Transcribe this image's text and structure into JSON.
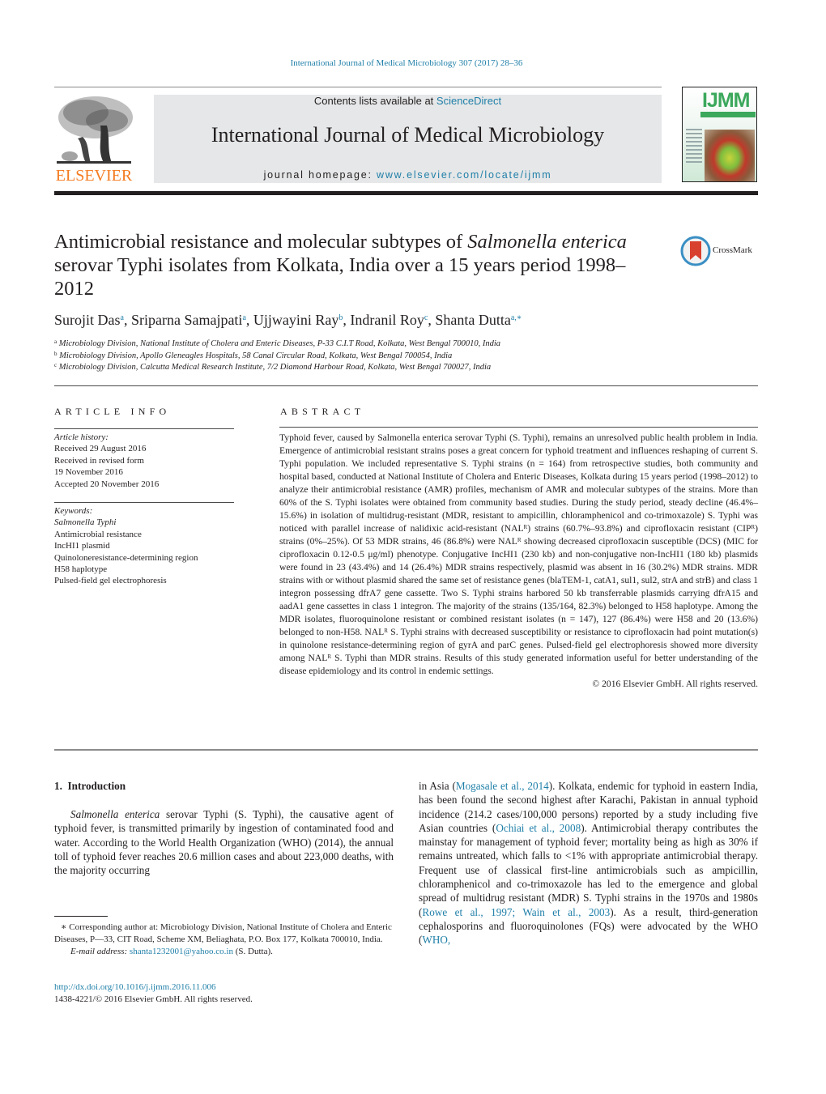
{
  "header": {
    "journal_ref": "International Journal of Medical Microbiology 307 (2017) 28–36",
    "publisher_logo_text": "ELSEVIER",
    "contents_prefix": "Contents lists available at ",
    "contents_link": "ScienceDirect",
    "journal_title": "International Journal of Medical Microbiology",
    "homepage_prefix": "journal homepage: ",
    "homepage_link": "www.elsevier.com/locate/ijmm",
    "cover_title": "IJMM",
    "colors": {
      "link": "#1f7fa8",
      "elsevier_orange": "#f47b20",
      "header_box": "#e6e7e8",
      "cover_green": "#3ba85c"
    }
  },
  "article": {
    "title_part1": "Antimicrobial resistance and molecular subtypes of ",
    "title_italic1": "Salmonella enterica",
    "title_part2": " serovar Typhi isolates from Kolkata, India over a 15 years period 1998–2012",
    "crossmark_label": "CrossMark",
    "authors": [
      {
        "name": "Surojit Das",
        "sup": "a"
      },
      {
        "name": "Sriparna Samajpati",
        "sup": "a"
      },
      {
        "name": "Ujjwayini Ray",
        "sup": "b"
      },
      {
        "name": "Indranil Roy",
        "sup": "c"
      },
      {
        "name": "Shanta Dutta",
        "sup": "a,∗"
      }
    ],
    "affiliations": [
      {
        "sup": "a",
        "text": "Microbiology Division, National Institute of Cholera and Enteric Diseases, P-33 C.I.T Road, Kolkata, West Bengal 700010, India"
      },
      {
        "sup": "b",
        "text": "Microbiology Division, Apollo Gleneagles Hospitals, 58 Canal Circular Road, Kolkata, West Bengal 700054, India"
      },
      {
        "sup": "c",
        "text": "Microbiology Division, Calcutta Medical Research Institute, 7/2 Diamond Harbour Road, Kolkata, West Bengal 700027, India"
      }
    ]
  },
  "article_info": {
    "heading": "ARTICLE INFO",
    "history_label": "Article history:",
    "history": [
      "Received 29 August 2016",
      "Received in revised form",
      "19 November 2016",
      "Accepted 20 November 2016"
    ],
    "keywords_label": "Keywords:",
    "keywords": [
      "Salmonella Typhi",
      "Antimicrobial resistance",
      "IncHI1 plasmid",
      "Quinoloneresistance-determining region",
      "H58 haplotype",
      "Pulsed-field gel electrophoresis"
    ]
  },
  "abstract": {
    "heading": "ABSTRACT",
    "text": "Typhoid fever, caused by Salmonella enterica serovar Typhi (S. Typhi), remains an unresolved public health problem in India. Emergence of antimicrobial resistant strains poses a great concern for typhoid treatment and influences reshaping of current S. Typhi population. We included representative S. Typhi strains (n = 164) from retrospective studies, both community and hospital based, conducted at National Institute of Cholera and Enteric Diseases, Kolkata during 15 years period (1998–2012) to analyze their antimicrobial resistance (AMR) profiles, mechanism of AMR and molecular subtypes of the strains. More than 60% of the S. Typhi isolates were obtained from community based studies. During the study period, steady decline (46.4%–15.6%) in isolation of multidrug-resistant (MDR, resistant to ampicillin, chloramphenicol and co-trimoxazole) S. Typhi was noticed with parallel increase of nalidixic acid-resistant (NALᴿ) strains (60.7%–93.8%) and ciprofloxacin resistant (CIPᴿ) strains (0%–25%). Of 53 MDR strains, 46 (86.8%) were NALᴿ showing decreased ciprofloxacin susceptible (DCS) (MIC for ciprofloxacin 0.12-0.5 μg/ml) phenotype. Conjugative IncHI1 (230 kb) and non-conjugative non-IncHI1 (180 kb) plasmids were found in 23 (43.4%) and 14 (26.4%) MDR strains respectively, plasmid was absent in 16 (30.2%) MDR strains. MDR strains with or without plasmid shared the same set of resistance genes (blaTEM-1, catA1, sul1, sul2, strA and strB) and class 1 integron possessing dfrA7 gene cassette. Two S. Typhi strains harbored 50 kb transferrable plasmids carrying dfrA15 and aadA1 gene cassettes in class 1 integron. The majority of the strains (135/164, 82.3%) belonged to H58 haplotype. Among the MDR isolates, fluoroquinolone resistant or combined resistant isolates (n = 147), 127 (86.4%) were H58 and 20 (13.6%) belonged to non-H58. NALᴿ S. Typhi strains with decreased susceptibility or resistance to ciprofloxacin had point mutation(s) in quinolone resistance-determining region of gyrA and parC genes. Pulsed-field gel electrophoresis showed more diversity among NALᴿ S. Typhi than MDR strains. Results of this study generated information useful for better understanding of the disease epidemiology and its control in endemic settings.",
    "copyright": "© 2016 Elsevier GmbH. All rights reserved."
  },
  "body": {
    "section_number": "1.",
    "section_title": "Introduction",
    "left_italic": "Salmonella enterica",
    "left_text": " serovar Typhi (S. Typhi), the causative agent of typhoid fever, is transmitted primarily by ingestion of contaminated food and water. According to the World Health Organization (WHO) (2014), the annual toll of typhoid fever reaches 20.6 million cases and about 223,000 deaths, with the majority occurring",
    "right_segments": [
      {
        "t": "in Asia ("
      },
      {
        "t": "Mogasale et al., 2014",
        "link": true
      },
      {
        "t": "). Kolkata, endemic for typhoid in eastern India, has been found the second highest after Karachi, Pakistan in annual typhoid incidence (214.2 cases/100,000 persons) reported by a study including five Asian countries ("
      },
      {
        "t": "Ochiai et al., 2008",
        "link": true
      },
      {
        "t": "). Antimicrobial therapy contributes the mainstay for management of typhoid fever; mortality being as high as 30% if remains untreated, which falls to <1% with appropriate antimicrobial therapy. Frequent use of classical first-line antimicrobials such as ampicillin, chloramphenicol and co-trimoxazole has led to the emergence and global spread of multidrug resistant (MDR) S. Typhi strains in the 1970s and 1980s ("
      },
      {
        "t": "Rowe et al., 1997; Wain et al., 2003",
        "link": true
      },
      {
        "t": "). As a result, third-generation cephalosporins and fluoroquinolones (FQs) were advocated by the WHO ("
      },
      {
        "t": "WHO,",
        "link": true
      }
    ]
  },
  "footnotes": {
    "corresponding": "∗ Corresponding author at: Microbiology Division, National Institute of Cholera and Enteric Diseases, P—33, CIT Road, Scheme XM, Beliaghata, P.O. Box 177, Kolkata 700010, India.",
    "email_label": "E-mail address: ",
    "email": "shanta1232001@yahoo.co.in",
    "email_suffix": " (S. Dutta).",
    "doi": "http://dx.doi.org/10.1016/j.ijmm.2016.11.006",
    "issn_copyright": "1438-4221/© 2016 Elsevier GmbH. All rights reserved."
  }
}
